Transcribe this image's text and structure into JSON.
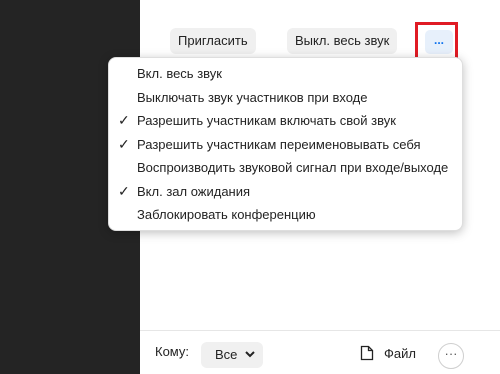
{
  "participants_panel": {
    "invite_label": "Пригласить",
    "mute_all_label": "Выкл. весь звук",
    "more_label": "..."
  },
  "more_menu": {
    "items": [
      {
        "label": "Вкл. весь звук",
        "checked": false
      },
      {
        "label": "Выключать звук участников при входе",
        "checked": false
      },
      {
        "label": "Разрешить участникам включать свой звук",
        "checked": true
      },
      {
        "label": "Разрешить участникам переименовывать себя",
        "checked": true
      },
      {
        "label": "Воспроизводить звуковой сигнал при входе/выходе",
        "checked": false
      },
      {
        "label": "Вкл. зал ожидания",
        "checked": true
      },
      {
        "label": "Заблокировать конференцию",
        "checked": false
      }
    ],
    "check_glyph": "✓"
  },
  "chat_footer": {
    "to_label": "Кому:",
    "recipient_value": "Все",
    "file_label": "Файл",
    "more_label": "···"
  },
  "colors": {
    "highlight_border": "#e01b24",
    "accent_blue": "#0e72ed",
    "left_pane_bg": "#242424"
  },
  "icons": {
    "chevron": "chevron-down-icon",
    "file": "file-icon",
    "check": "checkmark-icon"
  }
}
